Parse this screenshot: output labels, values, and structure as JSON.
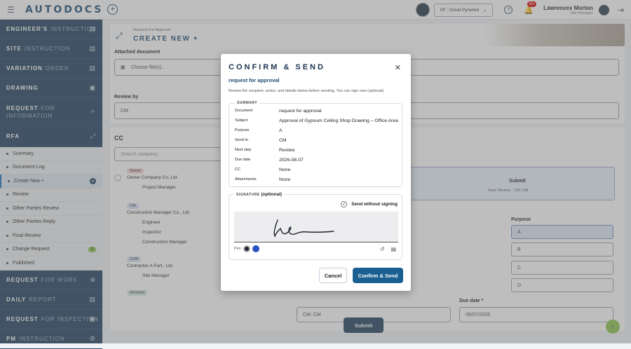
{
  "app": {
    "logo": "AUTODOCS",
    "project": "0P : Great Pyramid",
    "notif_count": "99+",
    "user_name": "Lawrencex Morton",
    "user_role": "Site Manager"
  },
  "sidebar": {
    "sections_top": [
      {
        "bold": "ENGINEER'S",
        "rest": "INSTRUCTION"
      },
      {
        "bold": "SITE",
        "rest": "INSTRUCTION"
      },
      {
        "bold": "VARIATION",
        "rest": "ORDER"
      },
      {
        "bold": "DRAWING",
        "rest": ""
      },
      {
        "bold": "REQUEST",
        "rest": "FOR INFORMATION"
      },
      {
        "bold": "RFA",
        "rest": ""
      }
    ],
    "rfa_items": [
      "Summary",
      "Document Log",
      "Create New +",
      "Review",
      "Other Parties Review",
      "Other Parties Reply",
      "Final Review",
      "Change Request",
      "Published"
    ],
    "change_request_count": "4",
    "sections_bottom": [
      {
        "bold": "REQUEST",
        "rest": "FOR WORK"
      },
      {
        "bold": "DAILY",
        "rest": "REPORT"
      },
      {
        "bold": "REQUEST",
        "rest": "FOR INSPECTION"
      },
      {
        "bold": "PM",
        "rest": "INSTRUCTION"
      }
    ]
  },
  "header": {
    "crumb": "Request For Approval",
    "title": "CREATE NEW +"
  },
  "form": {
    "attached_label": "Attached document",
    "choose_files": "Choose file(s)...",
    "review_by_label": "Review by",
    "review_by_value": "CM",
    "cc_title": "CC",
    "search_company": "Search company...",
    "owner_tag": "Owner",
    "owner_name": "Owner Company Co.,Ltd.",
    "owner_role": "Project Manager",
    "cm_tag": "CM",
    "cm_name": "Construction Manager Co., Ltd.",
    "cm_roles": [
      "Engineer",
      "Inspector",
      "Construction Manager"
    ],
    "con_tag": "CON",
    "con_name": "Contractor-A Part., Ltd.",
    "con_role": "Site Manager",
    "design_tag": "DESIGN",
    "step_submit": "Submit",
    "step_sub": "Next: Review · CM: CM",
    "purpose_label": "Purpose",
    "purpose_options": [
      "A",
      "B",
      "C",
      "D"
    ],
    "send_to_value": "CM: CM",
    "due_date_label": "Due date *",
    "due_date_value": "08/07/2026",
    "submit_button": "Submit"
  },
  "modal": {
    "title": "CONFIRM & SEND",
    "subtitle": "request for approval",
    "description": "Review the recipient, action, and details below before sending. You can sign now (optional).",
    "summary_label": "SUMMARY",
    "rows": [
      {
        "k": "Document",
        "v": "request for approval"
      },
      {
        "k": "Subject",
        "v": "Approval of Gypsum Ceiling Shop Drawing – Office Area"
      },
      {
        "k": "Purpose",
        "v": "A"
      },
      {
        "k": "Send to",
        "v": "CM"
      },
      {
        "k": "Next step",
        "v": "Review"
      },
      {
        "k": "Due date",
        "v": "2026-08-07"
      },
      {
        "k": "CC",
        "v": "None"
      },
      {
        "k": "Attachments",
        "v": "None"
      }
    ],
    "signature_label": "SIGNATURE",
    "signature_optional": "(optional)",
    "send_without_signing": "Send without signing",
    "pen_label": "Pen",
    "pen_colors": [
      "#1b2430",
      "#2c4fc4"
    ],
    "cancel": "Cancel",
    "confirm": "Confirm & Send"
  }
}
